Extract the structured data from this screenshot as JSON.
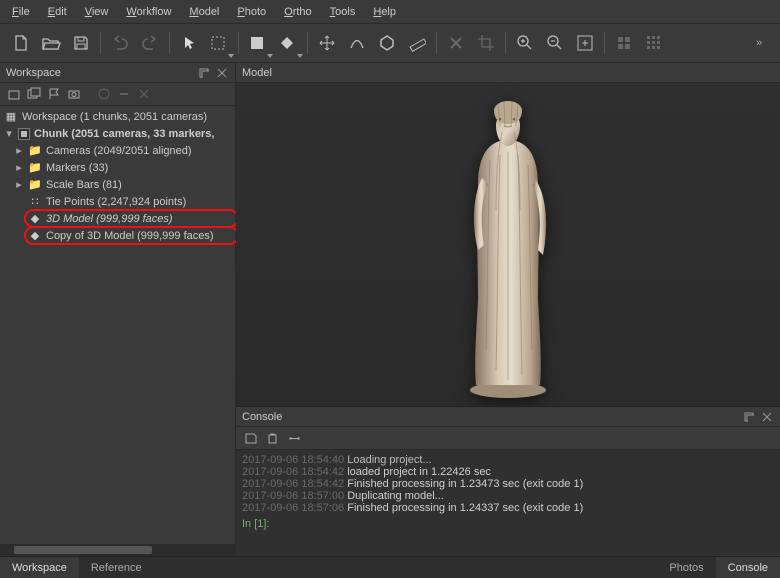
{
  "menu": [
    "File",
    "Edit",
    "View",
    "Workflow",
    "Model",
    "Photo",
    "Ortho",
    "Tools",
    "Help"
  ],
  "panels": {
    "workspace": "Workspace",
    "model": "Model",
    "console": "Console"
  },
  "tree": {
    "root": "Workspace (1 chunks, 2051 cameras)",
    "chunk": "Chunk (2051 cameras, 33 markers,",
    "cameras": "Cameras (2049/2051 aligned)",
    "markers": "Markers (33)",
    "scalebars": "Scale Bars (81)",
    "tiepoints": "Tie Points (2,247,924 points)",
    "model": "3D Model (999,999 faces)",
    "modelcopy": "Copy of 3D Model (999,999 faces)"
  },
  "console_lines": [
    {
      "ts": "2017-09-06 18:54:42",
      "msg": "loaded project in 1.22426 sec"
    },
    {
      "ts": "2017-09-06 18:54:42",
      "msg": "Finished processing in 1.23473 sec (exit code 1)"
    },
    {
      "ts": "2017-09-06 18:57:00",
      "msg": "Duplicating model..."
    },
    {
      "ts": "2017-09-06 18:57:06",
      "msg": "Finished processing in 1.24337 sec (exit code 1)"
    }
  ],
  "console_head": "Loading project...",
  "console_head_ts": "2017-09-06 18:54:40",
  "console_prompt": "In [1]:",
  "bottom_tabs_left": [
    "Workspace",
    "Reference"
  ],
  "bottom_tabs_right": [
    "Photos",
    "Console"
  ]
}
